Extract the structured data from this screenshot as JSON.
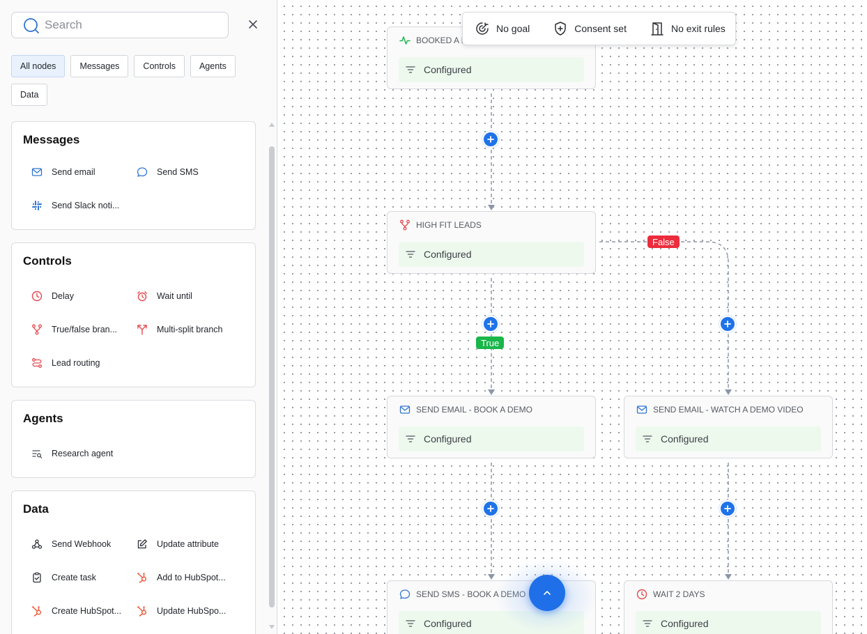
{
  "sidebar": {
    "search": {
      "placeholder": "Search",
      "value": ""
    },
    "filters": [
      "All nodes",
      "Messages",
      "Controls",
      "Agents",
      "Data"
    ],
    "active_filter": "All nodes",
    "sections": {
      "messages": {
        "title": "Messages",
        "items": [
          "Send email",
          "Send SMS",
          "Send Slack noti..."
        ]
      },
      "controls": {
        "title": "Controls",
        "items": [
          "Delay",
          "Wait until",
          "True/false bran...",
          "Multi-split branch",
          "Lead routing"
        ]
      },
      "agents": {
        "title": "Agents",
        "items": [
          "Research agent"
        ]
      },
      "data": {
        "title": "Data",
        "items": [
          "Send Webhook",
          "Update attribute",
          "Create task",
          "Add to HubSpot...",
          "Create HubSpot...",
          "Update HubSpo..."
        ]
      }
    }
  },
  "toolbar": {
    "goal": "No goal",
    "consent": "Consent set",
    "exit_rules": "No exit rules"
  },
  "nodes": {
    "booked": {
      "title": "BOOKED A D",
      "status": "Configured"
    },
    "high_fit": {
      "title": "HIGH FIT LEADS",
      "status": "Configured"
    },
    "email_book": {
      "title": "SEND EMAIL - BOOK A DEMO",
      "status": "Configured"
    },
    "email_watch": {
      "title": "SEND EMAIL - WATCH A DEMO VIDEO",
      "status": "Configured"
    },
    "sms_book": {
      "title": "SEND SMS - BOOK A DEMO",
      "status": "Configured"
    },
    "wait": {
      "title": "WAIT 2 DAYS",
      "status": "Configured"
    }
  },
  "branch_labels": {
    "true": "True",
    "false": "False"
  },
  "colors": {
    "accent": "#1f73e8",
    "true": "#19b64a",
    "false": "#ec2b3c",
    "message_icon": "#2f74d0",
    "control_icon": "#e5484d",
    "configured_bg": "#eef9ee"
  }
}
